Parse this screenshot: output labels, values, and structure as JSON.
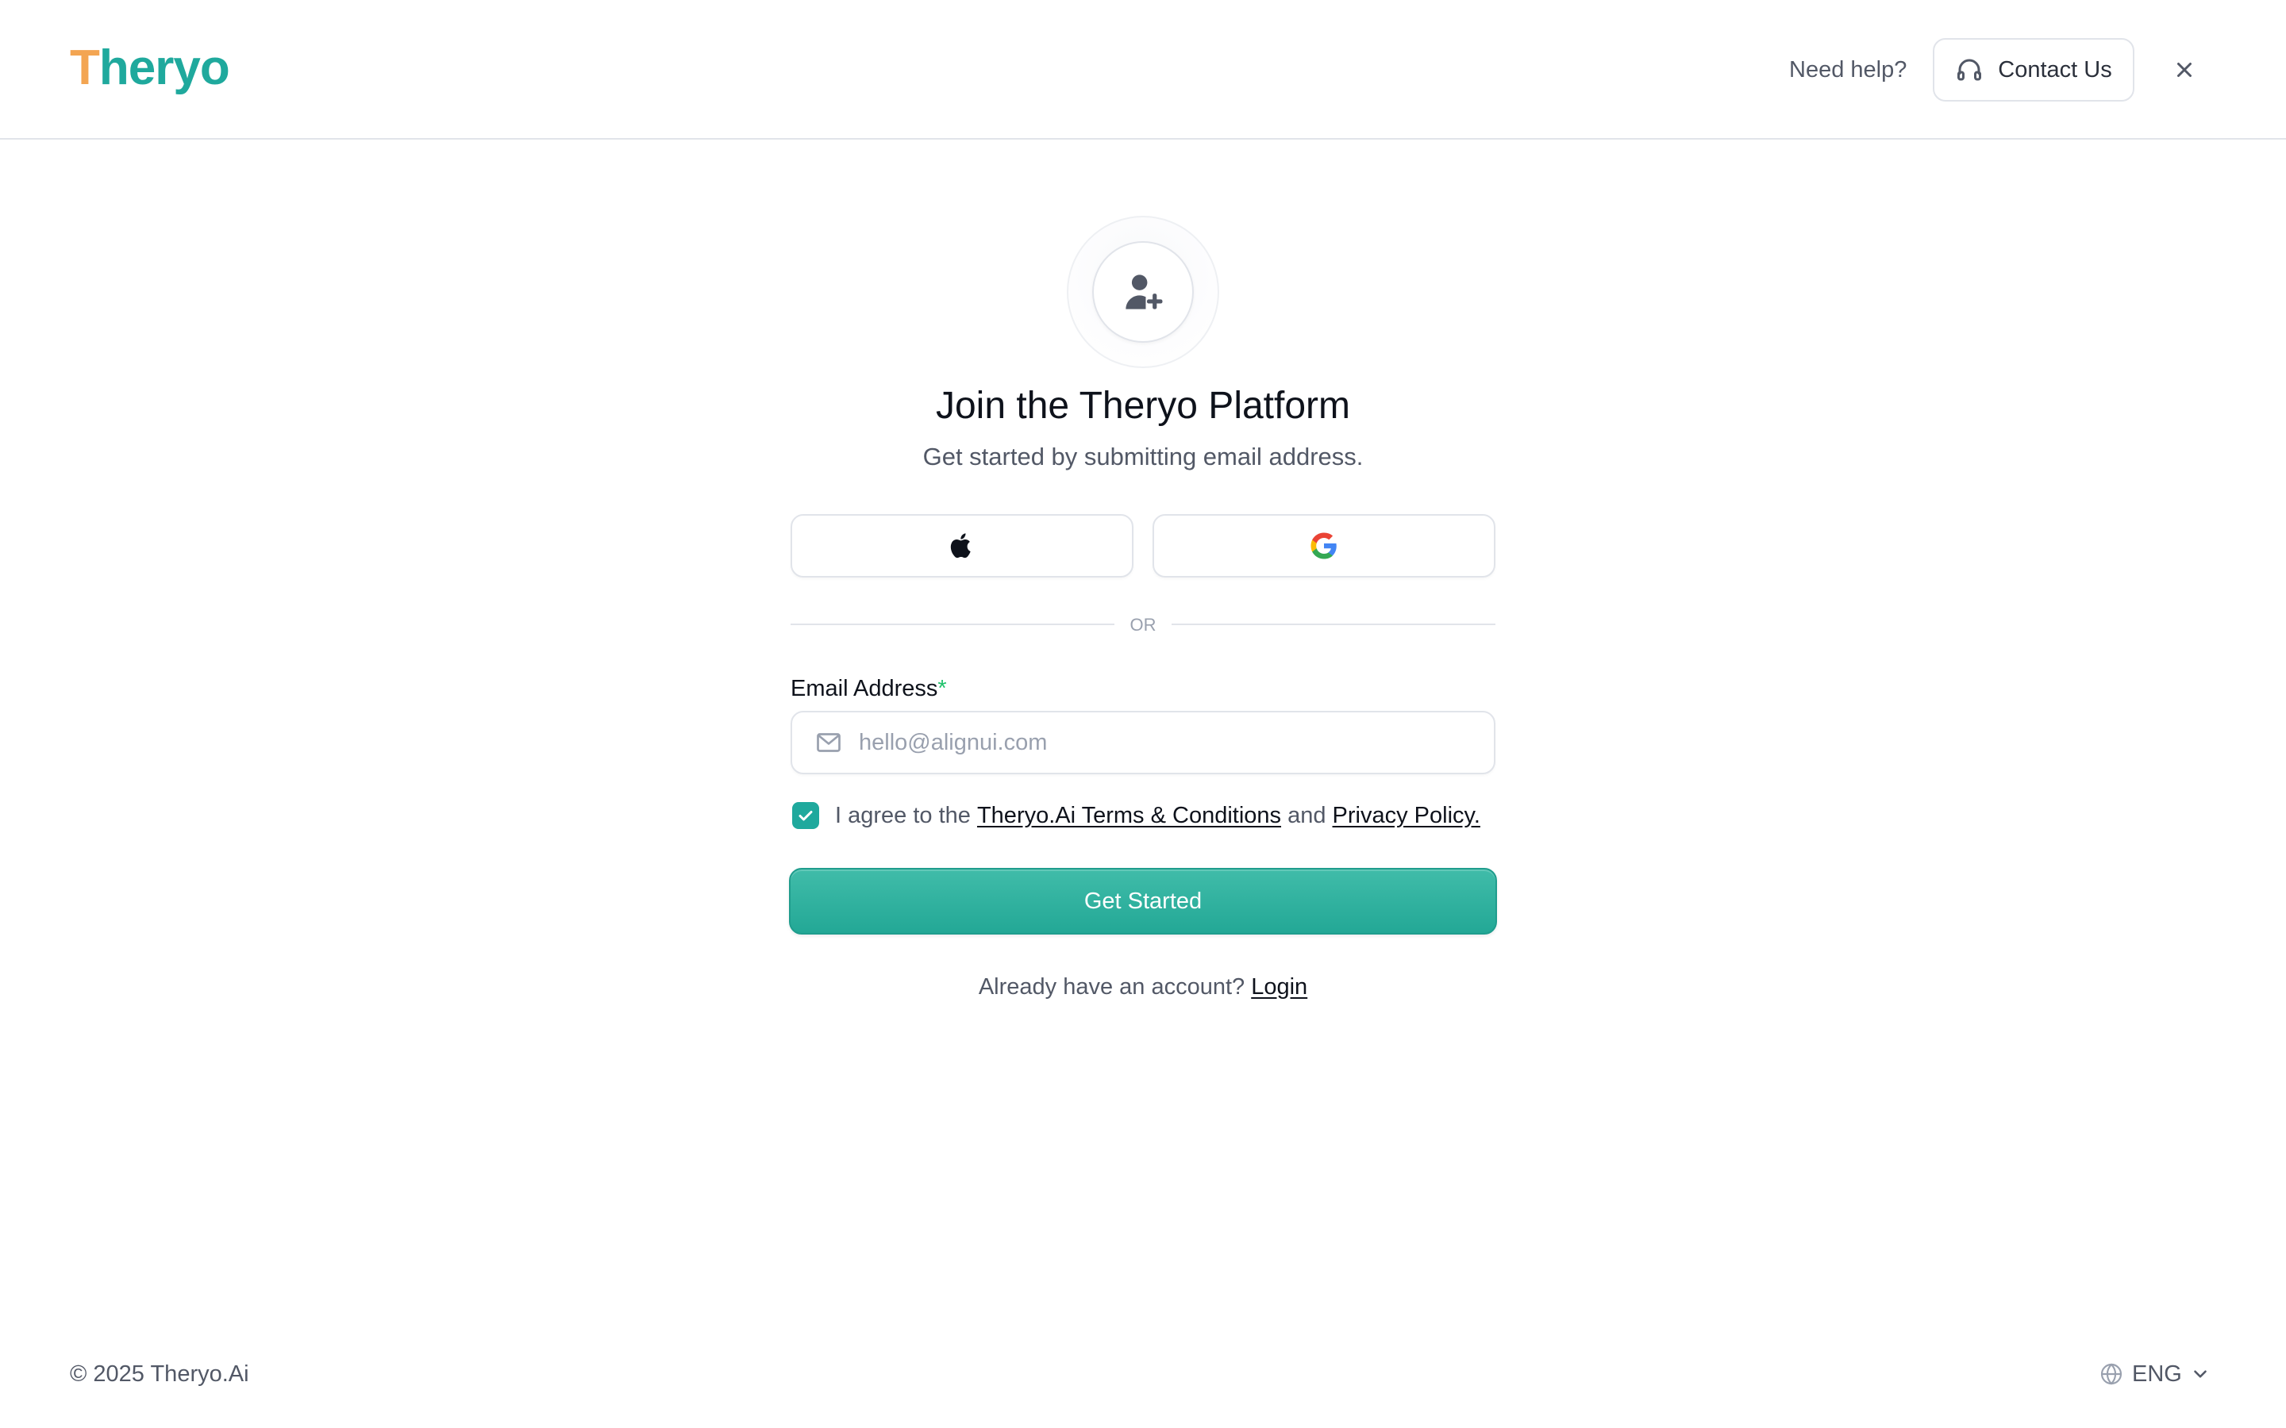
{
  "brand": {
    "logo_first": "T",
    "logo_rest": "heryo"
  },
  "header": {
    "help_text": "Need help?",
    "contact_label": "Contact Us"
  },
  "main": {
    "title": "Join the Theryo Platform",
    "subtitle": "Get started by submitting email address.",
    "divider_text": "OR",
    "email_label": "Email Address",
    "email_required_mark": "*",
    "email_placeholder": "hello@alignui.com",
    "email_value": "",
    "agree_checked": true,
    "agree_prefix": "I agree to the ",
    "terms_link": "Theryo.Ai Terms & Conditions",
    "agree_middle": " and ",
    "privacy_link": "Privacy Policy.",
    "submit_label": "Get Started",
    "login_prompt": "Already have an account? ",
    "login_link": "Login"
  },
  "footer": {
    "copyright": "© 2025 Theryo.Ai",
    "language": "ENG"
  },
  "icons": {
    "contact": "headphones-icon",
    "close": "close-icon",
    "avatar": "user-add-icon",
    "apple": "apple-icon",
    "google": "google-icon",
    "email": "mail-icon",
    "check": "check-icon",
    "language": "globe-icon",
    "dropdown": "chevron-down-icon"
  },
  "colors": {
    "brand_teal": "#1fa99d",
    "brand_orange": "#f3a552",
    "primary_button": "#2fb19f",
    "required": "#1fc16b"
  }
}
